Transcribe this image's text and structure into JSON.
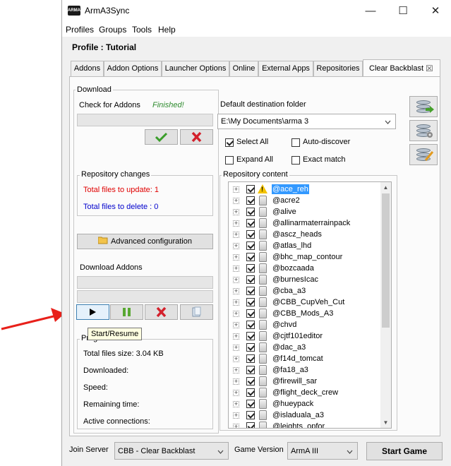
{
  "window": {
    "title": "ArmA3Sync",
    "minimize": "—",
    "maximize": "☐",
    "close": "✕"
  },
  "menu": [
    "Profiles",
    "Groups",
    "Tools",
    "Help"
  ],
  "profile_title": "Profile : Tutorial",
  "tabs": [
    {
      "label": "Addons"
    },
    {
      "label": "Addon Options"
    },
    {
      "label": "Launcher Options"
    },
    {
      "label": "Online"
    },
    {
      "label": "External Apps"
    },
    {
      "label": "Repositories"
    },
    {
      "label": "Clear Backblast",
      "close": "☒"
    }
  ],
  "download": {
    "group_title": "Download",
    "check_label": "Check for Addons",
    "check_status": "Finished!",
    "check_status_color": "#2e8b2e"
  },
  "repository_changes": {
    "title": "Repository changes",
    "update_text": "Total files to update: 1",
    "delete_text": "Total files to delete : 0",
    "update_color": "#e00000",
    "delete_color": "#0000cc"
  },
  "advanced_config": "Advanced configuration",
  "download_addons": {
    "title": "Download Addons",
    "tooltip": "Start/Resume"
  },
  "progress_monitor": {
    "title": "Progress monitor",
    "total_size": "Total files size: 3.04 KB",
    "downloaded": "Downloaded:",
    "speed": "Speed:",
    "remaining": "Remaining time:",
    "connections": "Active connections:"
  },
  "destination": {
    "label": "Default destination folder",
    "value": "E:\\My Documents\\arma 3"
  },
  "options": {
    "select_all": {
      "label": "Select All",
      "checked": true
    },
    "auto_discover": {
      "label": "Auto-discover",
      "checked": false
    },
    "expand_all": {
      "label": "Expand All",
      "checked": false
    },
    "exact_match": {
      "label": "Exact match",
      "checked": false
    }
  },
  "repository_content": {
    "title": "Repository content",
    "items": [
      {
        "name": "@ace_reh",
        "warning": true,
        "selected": true
      },
      {
        "name": "@acre2"
      },
      {
        "name": "@alive"
      },
      {
        "name": "@allinarmaterrainpack"
      },
      {
        "name": "@ascz_heads"
      },
      {
        "name": "@atlas_lhd"
      },
      {
        "name": "@bhc_map_contour"
      },
      {
        "name": "@bozcaada"
      },
      {
        "name": "@burnesIcac"
      },
      {
        "name": "@cba_a3"
      },
      {
        "name": "@CBB_CupVeh_Cut"
      },
      {
        "name": "@CBB_Mods_A3"
      },
      {
        "name": "@chvd"
      },
      {
        "name": "@cjtf101editor"
      },
      {
        "name": "@dac_a3"
      },
      {
        "name": "@f14d_tomcat"
      },
      {
        "name": "@fa18_a3"
      },
      {
        "name": "@firewill_sar"
      },
      {
        "name": "@flight_deck_crew"
      },
      {
        "name": "@hueypack"
      },
      {
        "name": "@isladuala_a3"
      },
      {
        "name": "@leights_opfor"
      }
    ]
  },
  "footer": {
    "join_server_label": "Join Server",
    "join_server_value": "CBB - Clear Backblast",
    "game_version_label": "Game Version",
    "game_version_value": "ArmA III",
    "start_game": "Start Game"
  },
  "colors": {
    "accent_selection": "#3399ff",
    "arrow": "#e8201a"
  },
  "icons": {
    "check": "check-icon",
    "cancel": "x-icon",
    "play": "play-icon",
    "pause": "pause-icon",
    "folder": "folder-icon",
    "copy": "copy-icon"
  }
}
